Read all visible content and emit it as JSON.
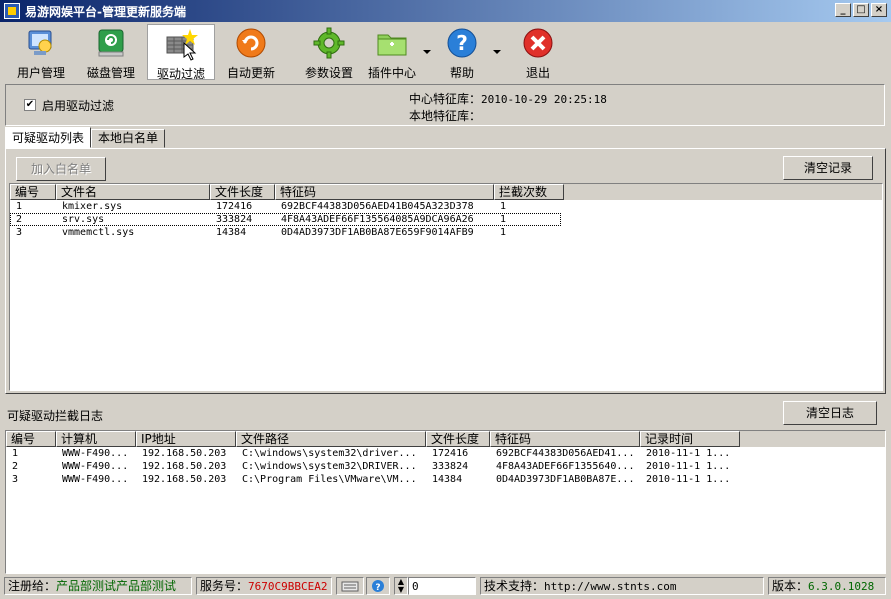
{
  "window": {
    "title": "易游网娱平台-管理更新服务端"
  },
  "toolbar": {
    "items": [
      {
        "label": "用户管理",
        "icon": "user-management-icon"
      },
      {
        "label": "磁盘管理",
        "icon": "disk-management-icon"
      },
      {
        "label": "驱动过滤",
        "icon": "driver-filter-icon",
        "active": true
      },
      {
        "label": "自动更新",
        "icon": "auto-update-icon"
      },
      {
        "label": "参数设置",
        "icon": "settings-gear-icon"
      },
      {
        "label": "插件中心",
        "icon": "plugin-folder-icon"
      },
      {
        "label": "帮助",
        "icon": "help-icon"
      },
      {
        "label": "退出",
        "icon": "exit-icon"
      }
    ]
  },
  "filter": {
    "enable_label": "启用驱动过滤",
    "enabled": true,
    "center_lib_label": "中心特征库：",
    "center_lib_value": "2010-10-29 20:25:18",
    "local_lib_label": "本地特征库：",
    "local_lib_value": ""
  },
  "tabs": [
    {
      "label": "可疑驱动列表"
    },
    {
      "label": "本地白名单"
    }
  ],
  "suspect_list": {
    "add_whitelist_label": "加入白名单",
    "clear_label": "清空记录",
    "columns": [
      "编号",
      "文件名",
      "文件长度",
      "特征码",
      "拦截次数"
    ],
    "rows": [
      [
        "1",
        "kmixer.sys",
        "172416",
        "692BCF44383D056AED41B045A323D378",
        "1"
      ],
      [
        "2",
        "srv.sys",
        "333824",
        "4F8A43ADEF66F135564085A9DCA96A26",
        "1"
      ],
      [
        "3",
        "vmmemctl.sys",
        "14384",
        "0D4AD3973DF1AB0BA87E659F9014AFB9",
        "1"
      ]
    ]
  },
  "log": {
    "title": "可疑驱动拦截日志",
    "clear_label": "清空日志",
    "columns": [
      "编号",
      "计算机",
      "IP地址",
      "文件路径",
      "文件长度",
      "特征码",
      "记录时间"
    ],
    "rows": [
      [
        "1",
        "WWW-F490...",
        "192.168.50.203",
        "C:\\windows\\system32\\driver...",
        "172416",
        "692BCF44383D056AED41...",
        "2010-11-1 1..."
      ],
      [
        "2",
        "WWW-F490...",
        "192.168.50.203",
        "C:\\windows\\system32\\DRIVER...",
        "333824",
        "4F8A43ADEF66F1355640...",
        "2010-11-1 1..."
      ],
      [
        "3",
        "WWW-F490...",
        "192.168.50.203",
        "C:\\Program Files\\VMware\\VM...",
        "14384",
        "0D4AD3973DF1AB0BA87E...",
        "2010-11-1 1..."
      ]
    ]
  },
  "status": {
    "registered_label": "注册给：",
    "registered_value": "产品部测试产品部测试",
    "service_label": "服务号：",
    "service_value": "7670C9BBCEA2",
    "spin_value": "0",
    "support_label": "技术支持：",
    "support_url": "http://www.stnts.com",
    "version_label": "版本：",
    "version_value": "6.3.0.1028"
  },
  "colors": {
    "title_start": "#0a246a",
    "title_end": "#a6caf0",
    "status_green": "#006600",
    "status_red": "#cc0000"
  }
}
